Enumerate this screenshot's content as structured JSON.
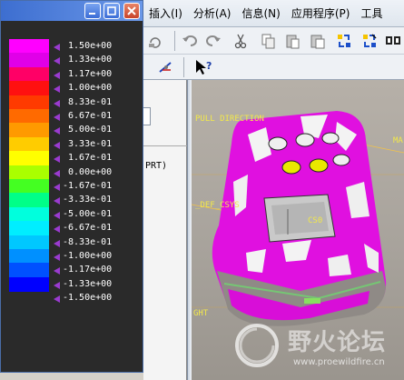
{
  "legend_window": {
    "title": "",
    "buttons": {
      "minimize": "minimize",
      "maximize": "maximize",
      "close": "close"
    },
    "colors": [
      "#ff00ff",
      "#e000e8",
      "#ff0066",
      "#ff1010",
      "#ff3a00",
      "#ff6a00",
      "#ff9a00",
      "#ffcc00",
      "#ffff00",
      "#aaff00",
      "#44ff22",
      "#00ff88",
      "#00ffdd",
      "#00eeff",
      "#00c8ff",
      "#0090ff",
      "#0050ff",
      "#0000ff"
    ],
    "values": [
      "1.50e+00",
      "1.33e+00",
      "1.17e+00",
      "1.00e+00",
      "8.33e-01",
      "6.67e-01",
      "5.00e-01",
      "3.33e-01",
      "1.67e-01",
      "0.00e+00",
      "-1.67e-01",
      "-3.33e-01",
      "-5.00e-01",
      "-6.67e-01",
      "-8.33e-01",
      "-1.00e+00",
      "-1.17e+00",
      "-1.33e+00",
      "-1.50e+00"
    ]
  },
  "menubar": {
    "items": [
      "插入(I)",
      "分析(A)",
      "信息(N)",
      "应用程序(P)",
      "工具"
    ]
  },
  "toolbar": {
    "icons": [
      "rotate-icon",
      "undo-icon",
      "redo-icon",
      "cut-icon",
      "copy-icon",
      "paste-icon",
      "paste-special-icon",
      "regenerate-icon",
      "regenerate-manager-icon",
      "window-icon"
    ]
  },
  "toolbar2": {
    "icons": [
      "datum-display-icon",
      "whats-this-icon"
    ]
  },
  "navigator": {
    "text": "PRT)"
  },
  "viewport": {
    "labels": {
      "pull_direction": "PULL DIRECTION",
      "def_csys": "_DEF_CSYS",
      "cs0": "CS0",
      "ma": "MA",
      "ght": "GHT"
    }
  },
  "watermark": {
    "text": "野火论坛",
    "url": "www.proewildfire.cn"
  }
}
